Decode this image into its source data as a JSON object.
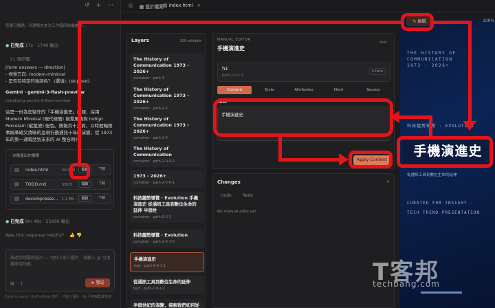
{
  "chat": {
    "top_icons": [
      "history-icon",
      "plus-icon",
      "more-icon"
    ],
    "status_line": "答案已傳達，代理將在本次工作階段後續處理…",
    "done1_label": "已完成",
    "done1_meta": "17s · 1749 輸出",
    "steps_label": "11 項步驟",
    "form_lines": [
      "[form answers — direction]",
      "- 視覺方向: modern-minimal",
      "- 是否有特定的強調色？ (選填): (skipped)"
    ],
    "model_line": "Gemini · gemini-3-flash-preview",
    "init_line": "initializing gemini-3-flash-preview",
    "paragraph": "這是一份為您製作的「手機演進史」簡報，採用 Modern Minimal (現代極簡) 視覺風格與 Indigo Porcelain (靛藍瓷) 配色。簡報共十六頁，以時間軸敘事既準確又清晰的呈現行動通訊十年的演變，從 1973 年的第一通電話到未來的 AI 整合時代。",
    "files_header": "本輪產出的檔案",
    "files": [
      {
        "name": "index.html",
        "size": "25.0 KB",
        "open": "開啟",
        "download": "下載"
      },
      {
        "name": "TODO.md",
        "size": "536 B",
        "open": "開啟",
        "download": "下載"
      },
      {
        "name": "decompresse…",
        "size": "1.1 MB",
        "open": "開啟",
        "download": "下載"
      }
    ],
    "done2_label": "已完成",
    "done2_meta": "8m 48s · 25896 輸出",
    "helpful": "Was this response helpful?",
    "input_placeholder": "描述你想要的設計 — 可附上他人圖片、或輸入 @ 引用檔案或技能。",
    "send_label": "發送",
    "footer": "Enter to send · Shift+Enter 換行 · 可貼上圖片 · @ 引用檔案或技能"
  },
  "tabbar": {
    "tab1": "設計檔案",
    "tab2": "index.html"
  },
  "layers": {
    "title": "Layers",
    "count": "209 editable",
    "items": [
      {
        "title": "The History of Communication 1973 - 2026+",
        "sub": "container · path-3"
      },
      {
        "title": "The History of Communication 1973 - 2026+",
        "sub": "container · path-2-3"
      },
      {
        "title": "The History of Communication 1973 - 2026+",
        "sub": "container · path-2-0"
      },
      {
        "title": "The History of Communication",
        "sub": "container · path-2-0-0-0"
      },
      {
        "title": "1973 - 2026+",
        "sub": "container · path-2-0-0-1"
      },
      {
        "title": "科技趨勢導覽 · Evolution 手機演進史 從通訊工具到數位生命的延伸 半個世",
        "sub": "container · path-2-0-1"
      },
      {
        "title": "科技趨勢導覽 · Evolution",
        "sub": "container · path-2-0-1-0"
      },
      {
        "title": "手機演進史",
        "sub": "text · path-2-0-1-1"
      },
      {
        "title": "從通訊工具到數位生命的延伸",
        "sub": "text · path-2-0-1-2"
      },
      {
        "title": "半個世紀的演變，探索我們如何從",
        "sub": ""
      }
    ]
  },
  "editor": {
    "header": "MANUAL EDITOR",
    "title": "手機演進史",
    "type": "text",
    "tag": "h1",
    "path": "path-2-0-1-1",
    "badge": "h-hero",
    "tabs": [
      "Content",
      "Style",
      "Attributes",
      "Html",
      "Source"
    ],
    "text_label": "Text",
    "text_value": "手機演進史",
    "apply_label": "Apply Content"
  },
  "changes": {
    "title": "Changes",
    "count": "0",
    "undo": "Undo",
    "redo": "Redo",
    "empty": "No manual edits yet."
  },
  "preview": {
    "edit_chip": "編輯",
    "zoom": "100%",
    "line1": "THE HISTORY OF",
    "line2": "COMMUNICATION",
    "line3": "1973 - 2026+",
    "kicker": "科技趨勢導覽 · EVOLUTION",
    "big_title": "手機演進史",
    "subtitle": "從通訊工具到數位生命的延伸",
    "curated": "CURATED FOR INSIGHT ·",
    "trend": "TECH TREND PRESENTATION"
  },
  "watermark": {
    "big": "T客邦",
    "small": "techbang.com"
  },
  "colors": {
    "accent": "#e07a5a",
    "annotation": "#e3151b",
    "preview_bg": "#0c2455"
  }
}
